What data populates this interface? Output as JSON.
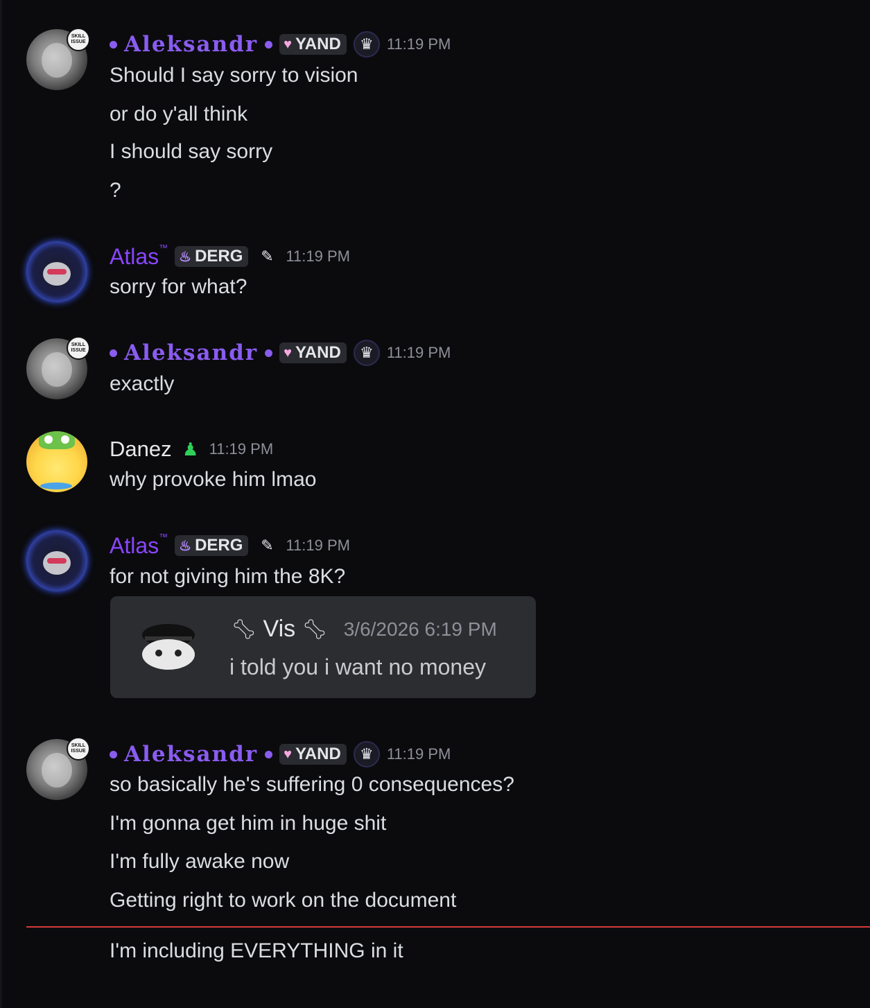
{
  "messages": [
    {
      "author": "Aleksandr",
      "tag": "YAND",
      "time": "11:19 PM",
      "avatar_badge": "SKILL ISSUE",
      "lines": [
        "Should I say sorry to vision",
        "or do y'all think",
        "I should say sorry",
        "?"
      ]
    },
    {
      "author": "Atlas",
      "author_mark": "™",
      "tag": "DERG",
      "time": "11:19 PM",
      "lines": [
        "sorry for what?"
      ]
    },
    {
      "author": "Aleksandr",
      "tag": "YAND",
      "time": "11:19 PM",
      "avatar_badge": "SKILL ISSUE",
      "lines": [
        "exactly"
      ]
    },
    {
      "author": "Danez",
      "time": "11:19 PM",
      "lines": [
        "why provoke him lmao"
      ]
    },
    {
      "author": "Atlas",
      "author_mark": "™",
      "tag": "DERG",
      "time": "11:19 PM",
      "lines": [
        "for not giving him the 8K?"
      ],
      "quote": {
        "author": "Vis",
        "time": "3/6/2026 6:19 PM",
        "text": "i told you i want no money"
      }
    },
    {
      "author": "Aleksandr",
      "tag": "YAND",
      "time": "11:19 PM",
      "avatar_badge": "SKILL ISSUE",
      "lines": [
        "so basically he's suffering 0 consequences?",
        "I'm gonna get him in huge shit",
        "I'm fully awake now",
        "Getting right to work on the document"
      ]
    },
    {
      "lines": [
        "I'm including EVERYTHING in it"
      ]
    }
  ],
  "colors": {
    "background": "#0b0b0e",
    "aleksandr_name": "#8a5cf0",
    "atlas_name": "#8a45ff",
    "new_messages_divider": "#d23a3a"
  },
  "icons": {
    "yand_tag": "heart-icon",
    "derg_tag": "flame-icon",
    "aleksandr_role": "crown-icon",
    "atlas_role": "pen-icon",
    "danez_role": "person-icon",
    "vis_name_deco": "bone-icon"
  }
}
